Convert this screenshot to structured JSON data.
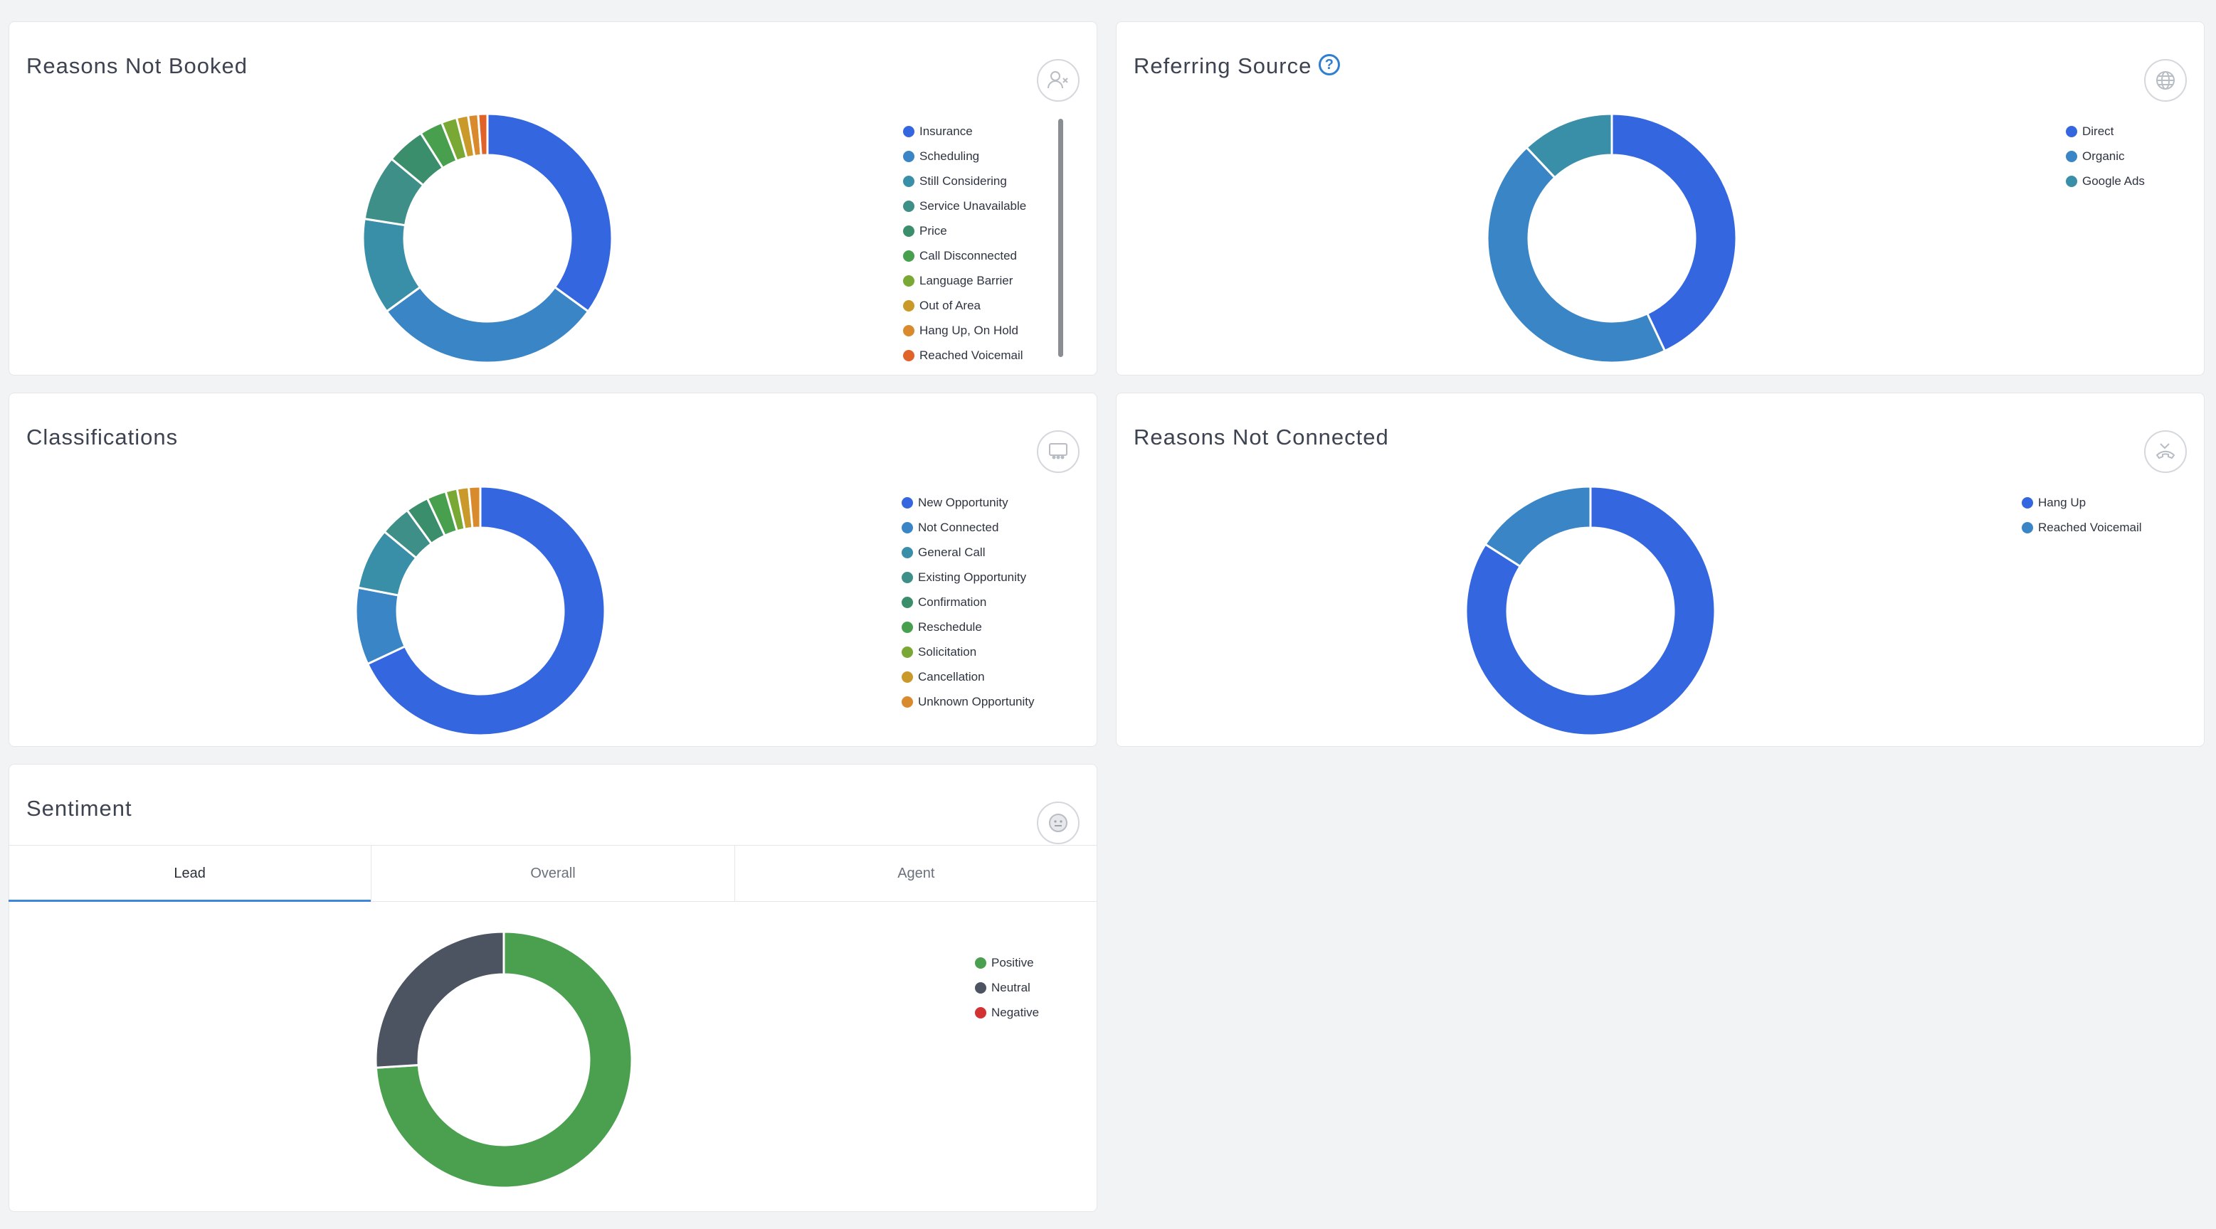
{
  "cards": {
    "reasons_not_booked": {
      "title": "Reasons Not Booked",
      "icon": "user-x-icon",
      "chart_data": {
        "type": "pie",
        "labels": [
          "Insurance",
          "Scheduling",
          "Still Considering",
          "Service Unavailable",
          "Price",
          "Call Disconnected",
          "Language Barrier",
          "Out of Area",
          "Hang Up, On Hold",
          "Reached Voicemail"
        ],
        "values": [
          35.0,
          30.0,
          12.5,
          8.5,
          5.0,
          3.0,
          2.0,
          1.5,
          1.3,
          1.2
        ],
        "colors": [
          "#3466e0",
          "#3a85c6",
          "#3a8fa8",
          "#3d8f88",
          "#3b8e6c",
          "#48a04e",
          "#7aa834",
          "#c99a2a",
          "#d98a2c",
          "#e0632a"
        ]
      }
    },
    "referring_source": {
      "title": "Referring Source",
      "icon": "globe-icon",
      "chart_data": {
        "type": "pie",
        "labels": [
          "Direct",
          "Organic",
          "Google Ads"
        ],
        "values": [
          43,
          45,
          12
        ],
        "colors": [
          "#3466e0",
          "#3a85c6",
          "#3a8fa8"
        ]
      }
    },
    "classifications": {
      "title": "Classifications",
      "icon": "people-board-icon",
      "chart_data": {
        "type": "pie",
        "labels": [
          "New Opportunity",
          "Not Connected",
          "General Call",
          "Existing Opportunity",
          "Confirmation",
          "Reschedule",
          "Solicitation",
          "Cancellation",
          "Unknown Opportunity"
        ],
        "values": [
          68.0,
          10.0,
          8.0,
          4.0,
          3.0,
          2.5,
          1.5,
          1.5,
          1.5
        ],
        "colors": [
          "#3466e0",
          "#3a85c6",
          "#3a8fa8",
          "#3d8f88",
          "#3b8e6c",
          "#48a04e",
          "#7aa834",
          "#c99a2a",
          "#d98a2c"
        ]
      }
    },
    "reasons_not_connected": {
      "title": "Reasons Not Connected",
      "icon": "phone-missed-icon",
      "chart_data": {
        "type": "pie",
        "labels": [
          "Hang Up",
          "Reached Voicemail"
        ],
        "values": [
          84,
          16
        ],
        "colors": [
          "#3466e0",
          "#3a85c6"
        ]
      }
    },
    "sentiment": {
      "title": "Sentiment",
      "icon": "face-icon",
      "tabs": [
        "Lead",
        "Overall",
        "Agent"
      ],
      "active_tab": "Lead",
      "chart_data": {
        "type": "pie",
        "labels": [
          "Positive",
          "Neutral",
          "Negative"
        ],
        "values": [
          74,
          26,
          0
        ],
        "colors": [
          "#4ba050",
          "#4c5361",
          "#d23232"
        ]
      }
    }
  }
}
